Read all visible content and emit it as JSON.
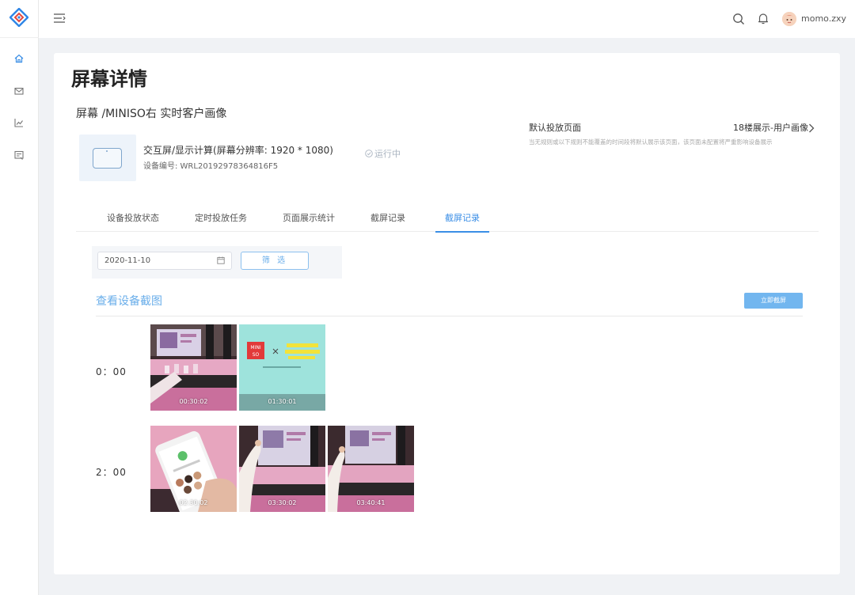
{
  "header": {
    "user_name": "momo.zxy"
  },
  "nav": {
    "items": [
      "home-icon",
      "mail-icon",
      "chart-icon",
      "report-icon"
    ]
  },
  "page": {
    "title": "屏幕详情",
    "screen_name": "屏幕 /MINISO右 实时客户画像"
  },
  "device": {
    "type": "交互屏/显示计算(屏幕分辨率:  1920 * 1080)",
    "code": "设备编号: WRL20192978364816F5",
    "status": "运行中"
  },
  "default_page": {
    "title": "默认投放页面",
    "value": "18楼展示-用户画像",
    "desc": "当无规则或以下规则不能覆盖的时间段将默认展示该页面，该页面未配置将严重影响设备展示"
  },
  "tabs": [
    {
      "label": "设备投放状态",
      "active": false
    },
    {
      "label": "定时投放任务",
      "active": false
    },
    {
      "label": "页面展示统计",
      "active": false
    },
    {
      "label": "截屏记录",
      "active": false
    },
    {
      "label": "截屏记录",
      "active": true
    }
  ],
  "filter": {
    "date": "2020-11-10",
    "button": "筛 选"
  },
  "screenshots": {
    "title": "查看设备截图",
    "capture_button": "立即截屏",
    "groups": [
      {
        "hour": "0：00",
        "items": [
          "00:30:02",
          "01:30:01"
        ]
      },
      {
        "hour": "2：00",
        "items": [
          "02:30:02",
          "03:30:02",
          "03:40:41"
        ]
      }
    ]
  },
  "colors": {
    "accent": "#3a8ee6",
    "accent_light": "#6aaeea",
    "button_fill": "#72b6ef",
    "background": "#f0f2f5"
  }
}
